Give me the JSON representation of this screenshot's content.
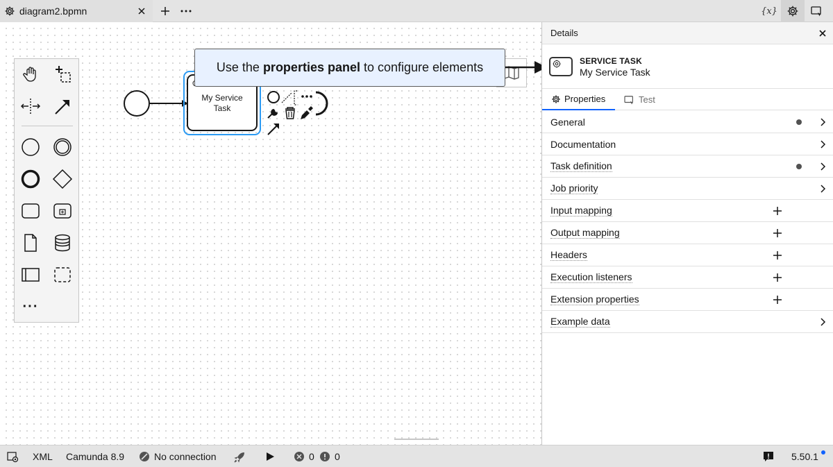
{
  "tabbar": {
    "tab_title": "diagram2.bpmn",
    "add_label": "+",
    "more_label": "···",
    "vars_label": "{x}"
  },
  "canvas": {
    "task_name_line1": "My Service",
    "task_name_line2": "Task",
    "callout_pre": "Use the ",
    "callout_bold": "properties panel",
    "callout_post": " to configure elements",
    "palette_more": "···"
  },
  "panel": {
    "title": "Details",
    "element_type": "SERVICE TASK",
    "element_name": "My Service Task",
    "tabs": [
      {
        "label": "Properties",
        "active": true
      },
      {
        "label": "Test",
        "active": false
      }
    ],
    "groups": [
      {
        "label": "General",
        "dot": true,
        "action": "chevron"
      },
      {
        "label": "Documentation",
        "dot": false,
        "action": "chevron"
      },
      {
        "label": "Task definition",
        "dot": true,
        "action": "chevron"
      },
      {
        "label": "Job priority",
        "dot": false,
        "action": "chevron"
      },
      {
        "label": "Input mapping",
        "dot": false,
        "action": "add"
      },
      {
        "label": "Output mapping",
        "dot": false,
        "action": "add"
      },
      {
        "label": "Headers",
        "dot": false,
        "action": "add"
      },
      {
        "label": "Execution listeners",
        "dot": false,
        "action": "add"
      },
      {
        "label": "Extension properties",
        "dot": false,
        "action": "add"
      },
      {
        "label": "Example data",
        "dot": false,
        "action": "chevron"
      }
    ]
  },
  "statusbar": {
    "xml_label": "XML",
    "engine_label": "Camunda 8.9",
    "connection_label": "No connection",
    "errors_count": "0",
    "warnings_count": "0",
    "version": "5.50.1"
  },
  "colors": {
    "accent": "#0f62fe",
    "selection": "#2b9af3",
    "callout_bg": "#e8f1ff"
  }
}
